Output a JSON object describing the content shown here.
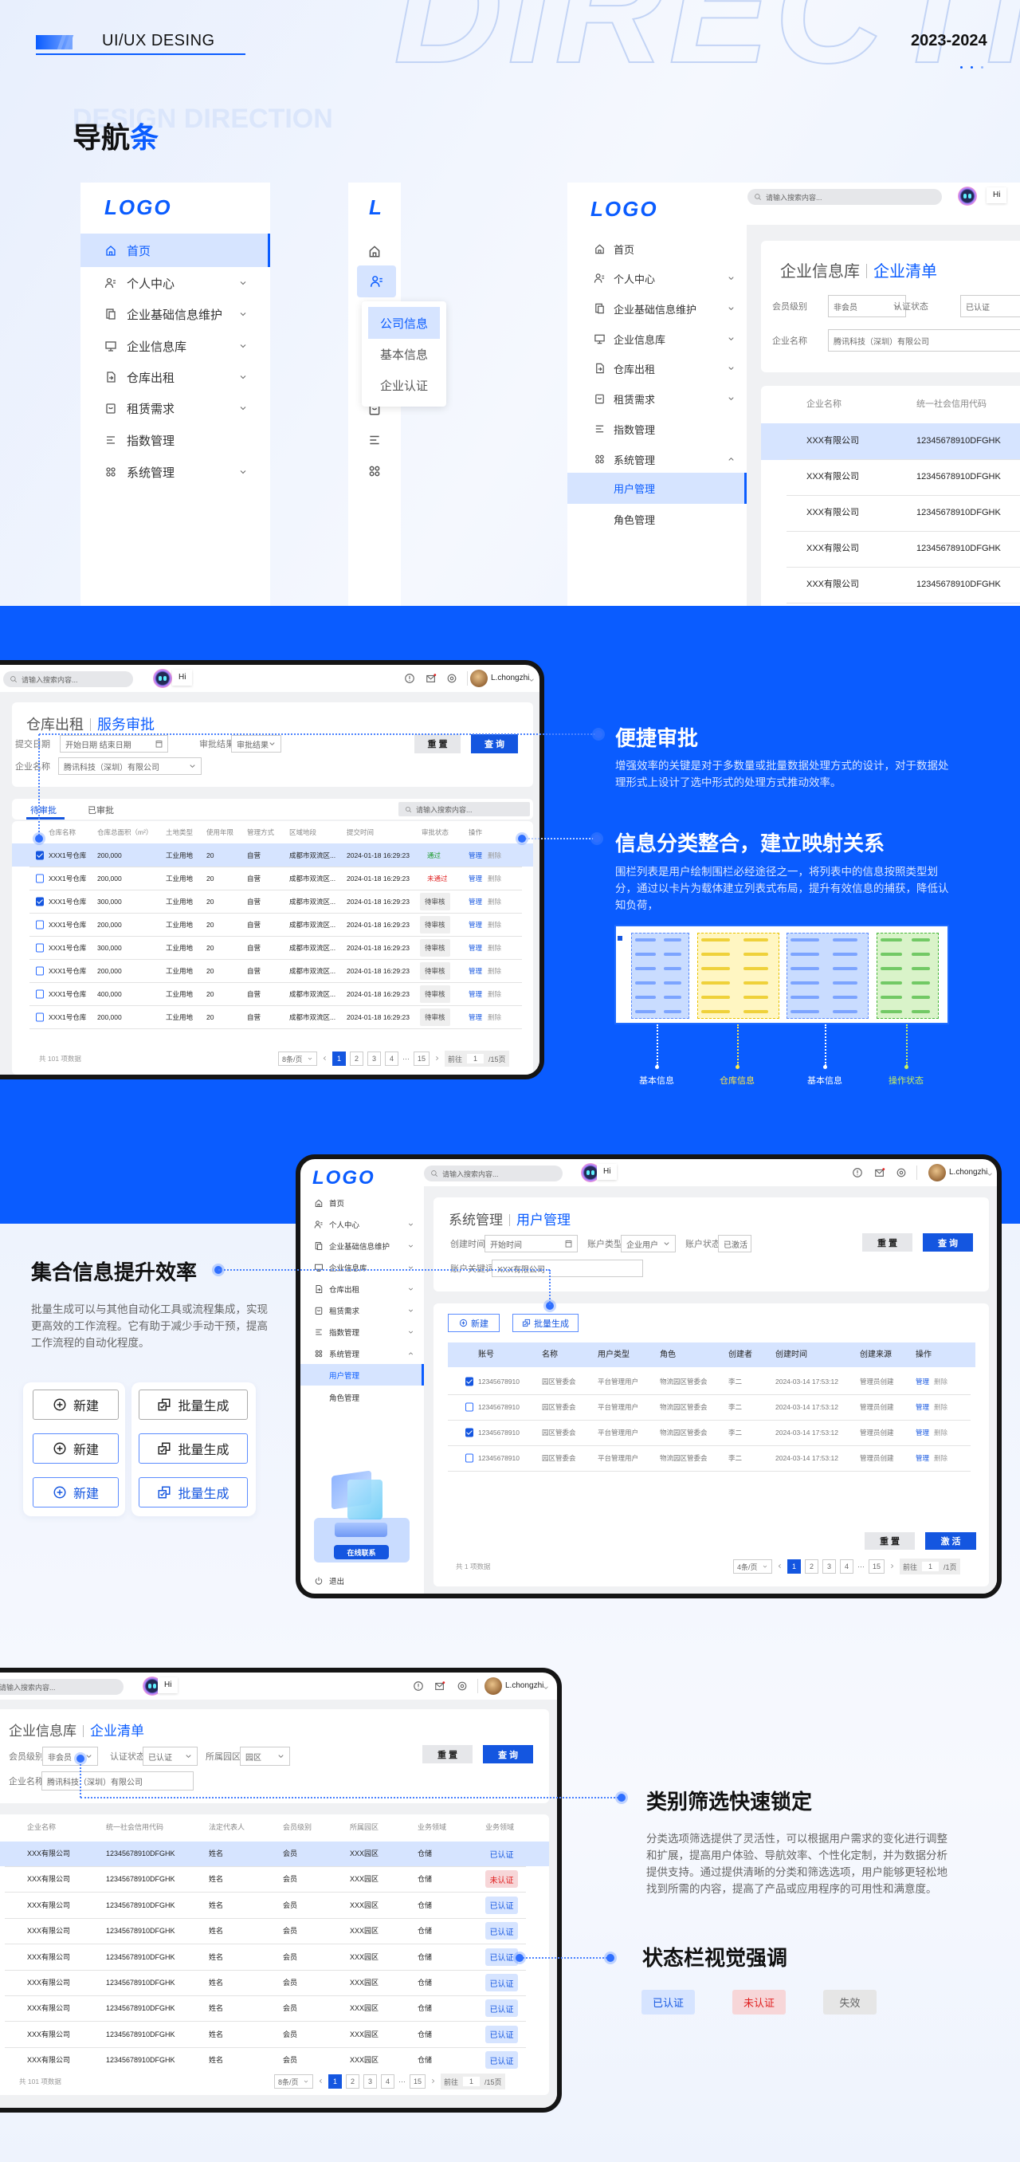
{
  "header": {
    "brand": "UI/UX DESING",
    "year": "2023-2024",
    "bg_word": "DIRECTION"
  },
  "nav_section": {
    "ghost": "DESIGN DIRECTION",
    "title_main": "导航",
    "title_accent": "条"
  },
  "logo": "LOGO",
  "logo_short": "L",
  "nav_items": [
    {
      "label": "首页",
      "icon": "home-icon",
      "chevron": false
    },
    {
      "label": "个人中心",
      "icon": "user-icon",
      "chevron": true
    },
    {
      "label": "企业基础信息维护",
      "icon": "document-icon",
      "chevron": true
    },
    {
      "label": "企业信息库",
      "icon": "monitor-icon",
      "chevron": true
    },
    {
      "label": "仓库出租",
      "icon": "file-import-icon",
      "chevron": true
    },
    {
      "label": "租赁需求",
      "icon": "bag-icon",
      "chevron": true
    },
    {
      "label": "指数管理",
      "icon": "list-icon",
      "chevron": false
    },
    {
      "label": "系统管理",
      "icon": "grid-icon",
      "chevron": true
    }
  ],
  "nav_sub": [
    "用户管理",
    "角色管理"
  ],
  "nav_popup": [
    "公司信息",
    "基本信息",
    "企业认证"
  ],
  "sidebar_extra": {
    "contact": "在线联系",
    "logout": "退出"
  },
  "common": {
    "search_placeholder": "请输入搜索内容...",
    "hi": "Hi",
    "user": "L.chongzhi",
    "reset": "重 置",
    "query": "查 询",
    "activate": "激 活",
    "manage": "管理",
    "delete": "删除",
    "ellipsis": "···",
    "goto_label": "前往"
  },
  "enterprise": {
    "crumb_parent": "企业信息库",
    "crumb_current": "企业清单",
    "filters": [
      {
        "label": "会员级别",
        "value": "非会员"
      },
      {
        "label": "认证状态",
        "value": "已认证"
      },
      {
        "label": "所属园区",
        "value": "园区"
      }
    ],
    "name_label": "企业名称",
    "name_value": "腾讯科技（深圳）有限公司",
    "headers": [
      "企业名称",
      "统一社会信用代码",
      "法定代表人",
      "会员级别",
      "所属园区",
      "业务领域",
      "业务领域"
    ],
    "rows": [
      {
        "name": "XXX有限公司",
        "code": "12345678910DFGHK",
        "legal": "姓名",
        "level": "会员",
        "park": "XXX园区",
        "field": "仓储",
        "status": "已认证",
        "status_type": "ok"
      },
      {
        "name": "XXX有限公司",
        "code": "12345678910DFGHK",
        "legal": "姓名",
        "level": "会员",
        "park": "XXX园区",
        "field": "仓储",
        "status": "未认证",
        "status_type": "no"
      },
      {
        "name": "XXX有限公司",
        "code": "12345678910DFGHK",
        "legal": "姓名",
        "level": "会员",
        "park": "XXX园区",
        "field": "仓储",
        "status": "已认证",
        "status_type": "ok"
      },
      {
        "name": "XXX有限公司",
        "code": "12345678910DFGHK",
        "legal": "姓名",
        "level": "会员",
        "park": "XXX园区",
        "field": "仓储",
        "status": "已认证",
        "status_type": "ok"
      },
      {
        "name": "XXX有限公司",
        "code": "12345678910DFGHK",
        "legal": "姓名",
        "level": "会员",
        "park": "XXX园区",
        "field": "仓储",
        "status": "已认证",
        "status_type": "ok"
      },
      {
        "name": "XXX有限公司",
        "code": "12345678910DFGHK",
        "legal": "姓名",
        "level": "会员",
        "park": "XXX园区",
        "field": "仓储",
        "status": "已认证",
        "status_type": "ok"
      },
      {
        "name": "XXX有限公司",
        "code": "12345678910DFGHK",
        "legal": "姓名",
        "level": "会员",
        "park": "XXX园区",
        "field": "仓储",
        "status": "已认证",
        "status_type": "ok"
      },
      {
        "name": "XXX有限公司",
        "code": "12345678910DFGHK",
        "legal": "姓名",
        "level": "会员",
        "park": "XXX园区",
        "field": "仓储",
        "status": "已认证",
        "status_type": "ok"
      },
      {
        "name": "XXX有限公司",
        "code": "12345678910DFGHK",
        "legal": "姓名",
        "level": "会员",
        "park": "XXX园区",
        "field": "仓储",
        "status": "已认证",
        "status_type": "ok"
      }
    ],
    "total": "共 101 项数据",
    "page_size": "8条/页",
    "pages": [
      "1",
      "2",
      "3",
      "4",
      "15"
    ],
    "goto_value": "1",
    "goto_total": "/15页"
  },
  "approval": {
    "crumb_parent": "仓库出租",
    "crumb_current": "服务审批",
    "date_label": "提交日期",
    "date_value": "开始日期 结束日期",
    "result_label": "审批结果",
    "result_value": "审批结果",
    "name_label": "企业名称",
    "name_value": "腾讯科技（深圳）有限公司",
    "tabs": [
      "待审批",
      "已审批"
    ],
    "headers": [
      "仓库名称",
      "仓库总面积（m²）",
      "土地类型",
      "使用年限",
      "管理方式",
      "区域地段",
      "提交时间",
      "审批状态",
      "操作"
    ],
    "rows": [
      {
        "checked": true,
        "name": "XXX1号仓库",
        "area": "200,000",
        "land": "工业用地",
        "years": "20",
        "mode": "自营",
        "region": "成都市双流区...",
        "time": "2024-01-18 16:29:23",
        "status": "通过",
        "status_type": "pass"
      },
      {
        "checked": false,
        "name": "XXX1号仓库",
        "area": "200,000",
        "land": "工业用地",
        "years": "20",
        "mode": "自营",
        "region": "成都市双流区...",
        "time": "2024-01-18 16:29:23",
        "status": "未通过",
        "status_type": "fail"
      },
      {
        "checked": true,
        "name": "XXX1号仓库",
        "area": "300,000",
        "land": "工业用地",
        "years": "20",
        "mode": "自营",
        "region": "成都市双流区...",
        "time": "2024-01-18 16:29:23",
        "status": "待审核",
        "status_type": "wait"
      },
      {
        "checked": false,
        "name": "XXX1号仓库",
        "area": "200,000",
        "land": "工业用地",
        "years": "20",
        "mode": "自营",
        "region": "成都市双流区...",
        "time": "2024-01-18 16:29:23",
        "status": "待审核",
        "status_type": "wait"
      },
      {
        "checked": false,
        "name": "XXX1号仓库",
        "area": "300,000",
        "land": "工业用地",
        "years": "20",
        "mode": "自营",
        "region": "成都市双流区...",
        "time": "2024-01-18 16:29:23",
        "status": "待审核",
        "status_type": "wait"
      },
      {
        "checked": false,
        "name": "XXX1号仓库",
        "area": "200,000",
        "land": "工业用地",
        "years": "20",
        "mode": "自营",
        "region": "成都市双流区...",
        "time": "2024-01-18 16:29:23",
        "status": "待审核",
        "status_type": "wait"
      },
      {
        "checked": false,
        "name": "XXX1号仓库",
        "area": "400,000",
        "land": "工业用地",
        "years": "20",
        "mode": "自营",
        "region": "成都市双流区...",
        "time": "2024-01-18 16:29:23",
        "status": "待审核",
        "status_type": "wait"
      },
      {
        "checked": false,
        "name": "XXX1号仓库",
        "area": "200,000",
        "land": "工业用地",
        "years": "20",
        "mode": "自营",
        "region": "成都市双流区...",
        "time": "2024-01-18 16:29:23",
        "status": "待审核",
        "status_type": "wait"
      }
    ],
    "total": "共 101 项数据",
    "page_size": "8条/页",
    "pages": [
      "1",
      "2",
      "3",
      "4",
      "15"
    ],
    "goto_value": "1",
    "goto_total": "/15页"
  },
  "users": {
    "crumb_parent": "系统管理",
    "crumb_current": "用户管理",
    "created_label": "创建时间",
    "created_value": "开始时间",
    "type_label": "账户类型",
    "type_value": "企业用户",
    "state_label": "账户状态",
    "state_value": "已激活",
    "keyword_label": "账户关键词",
    "keyword_value": "XXX有限公司",
    "new_label": "新建",
    "batch_label": "批量生成",
    "headers": [
      "账号",
      "名称",
      "用户类型",
      "角色",
      "创建者",
      "创建时间",
      "创建来源",
      "操作"
    ],
    "rows": [
      {
        "checked": true,
        "account": "12345678910",
        "name": "园区管委会",
        "type": "平台管理用户",
        "role": "物流园区管委会",
        "creator": "李二",
        "time": "2024-03-14 17:53:12",
        "source": "管理员创建"
      },
      {
        "checked": false,
        "account": "12345678910",
        "name": "园区管委会",
        "type": "平台管理用户",
        "role": "物流园区管委会",
        "creator": "李二",
        "time": "2024-03-14 17:53:12",
        "source": "管理员创建"
      },
      {
        "checked": true,
        "account": "12345678910",
        "name": "园区管委会",
        "type": "平台管理用户",
        "role": "物流园区管委会",
        "creator": "李二",
        "time": "2024-03-14 17:53:12",
        "source": "管理员创建"
      },
      {
        "checked": false,
        "account": "12345678910",
        "name": "园区管委会",
        "type": "平台管理用户",
        "role": "物流园区管委会",
        "creator": "李二",
        "time": "2024-03-14 17:53:12",
        "source": "管理员创建"
      }
    ],
    "total": "共 1 项数据",
    "page_size": "4条/页",
    "pages": [
      "1",
      "2",
      "3",
      "4",
      "15"
    ],
    "goto_value": "1",
    "goto_total": "/1页"
  },
  "features": {
    "quick_approve": {
      "title": "便捷审批",
      "text": "增强效率的关键是对于多数量或批量数据处理方式的设计，对于数据处理形式上设计了选中形式的处理方式推动效率。"
    },
    "classify": {
      "title": "信息分类整合，建立映射关系",
      "text": "围栏列表是用户绘制围栏必经途径之一，将列表中的信息按照类型划分，通过以卡片为载体建立列表式布局，提升有效信息的捕获，降低认知负荷，"
    },
    "legend": [
      "基本信息",
      "仓库信息",
      "基本信息",
      "操作状态"
    ],
    "collect": {
      "title": "集合信息提升效率",
      "text": "批量生成可以与其他自动化工具或流程集成，实现更高效的工作流程。它有助于减少手动干预，提高工作流程的自动化程度。",
      "new_label": "新建",
      "batch_label": "批量生成"
    },
    "filter": {
      "title": "类别筛选快速锁定",
      "text": "分类选项筛选提供了灵活性，可以根据用户需求的变化进行调整和扩展，提高用户体验、导航效率、个性化定制，并为数据分析提供支持。通过提供清晰的分类和筛选选项，用户能够更轻松地找到所需的内容，提高了产品或应用程序的可用性和满意度。"
    },
    "status": {
      "title": "状态栏视觉强调",
      "badges": [
        {
          "label": "已认证",
          "type": "ok"
        },
        {
          "label": "未认证",
          "type": "no"
        },
        {
          "label": "失效",
          "type": "off"
        }
      ]
    }
  },
  "colors": {
    "primary": "#0a5cff",
    "active_bg": "#d6e4ff",
    "danger": "#e02020",
    "success": "#1a9a2a",
    "legend_yellow": "#ffe94a",
    "legend_green": "#c8f060"
  }
}
